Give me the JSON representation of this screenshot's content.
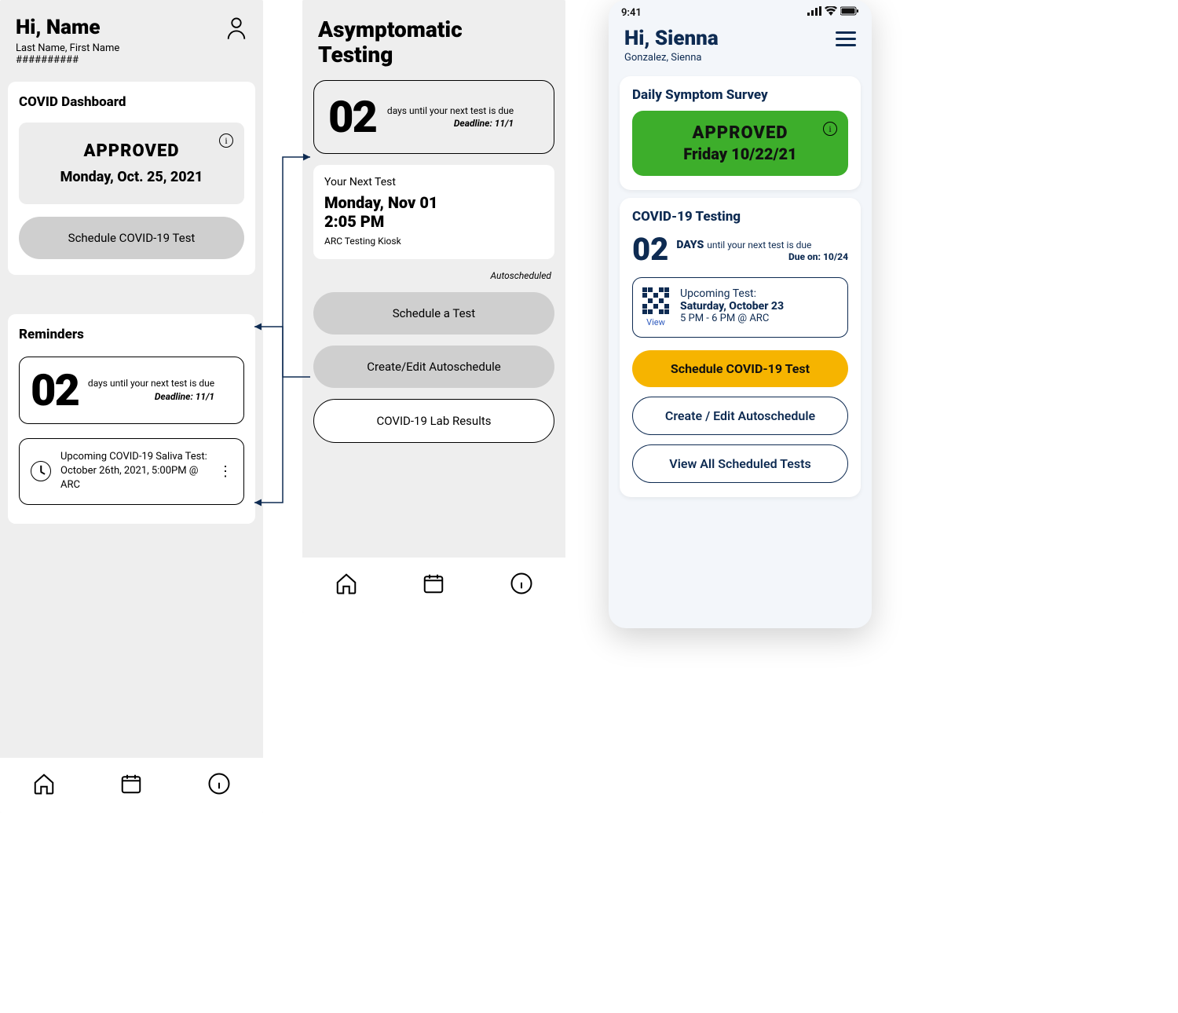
{
  "phone1": {
    "greeting": "Hi, Name",
    "subname": "Last Name, First Name",
    "idmask": "##########",
    "dash_title": "COVID Dashboard",
    "status": {
      "label": "APPROVED",
      "date": "Monday, Oct. 25, 2021"
    },
    "schedule_btn": "Schedule COVID-19 Test",
    "reminders_title": "Reminders",
    "countdown": {
      "num": "02",
      "text": "days until your next test is due",
      "deadline": "Deadline: 11/1"
    },
    "upcoming": "Upcoming COVID-19 Saliva Test: October 26th, 2021, 5:00PM @ ARC"
  },
  "phone2": {
    "title_l1": "Asymptomatic",
    "title_l2": "Testing",
    "countdown": {
      "num": "02",
      "text": "days until your next test is due",
      "deadline": "Deadline: 11/1"
    },
    "next_label": "Your Next Test",
    "next_date": "Monday, Nov 01",
    "next_time": "2:05 PM",
    "next_loc": "ARC Testing Kiosk",
    "auto_note": "Autoscheduled",
    "btn_schedule": "Schedule a Test",
    "btn_auto": "Create/Edit Autoschedule",
    "btn_results": "COVID-19 Lab Results"
  },
  "phone3": {
    "clock": "9:41",
    "greeting": "Hi, Sienna",
    "subname": "Gonzalez, Sienna",
    "survey_title": "Daily Symptom Survey",
    "status": {
      "label": "APPROVED",
      "date": "Friday 10/22/21"
    },
    "testing_title": "COVID-19 Testing",
    "countdown": {
      "num": "02",
      "days": "DAYS",
      "text": "until your next test is due",
      "due": "Due on: 10/24"
    },
    "upcoming": {
      "label": "Upcoming Test:",
      "date": "Saturday, October 23",
      "time": "5 PM - 6 PM @ ARC",
      "view": "View"
    },
    "btn_schedule": "Schedule COVID-19 Test",
    "btn_auto": "Create / Edit Autoschedule",
    "btn_viewall": "View All Scheduled Tests"
  }
}
